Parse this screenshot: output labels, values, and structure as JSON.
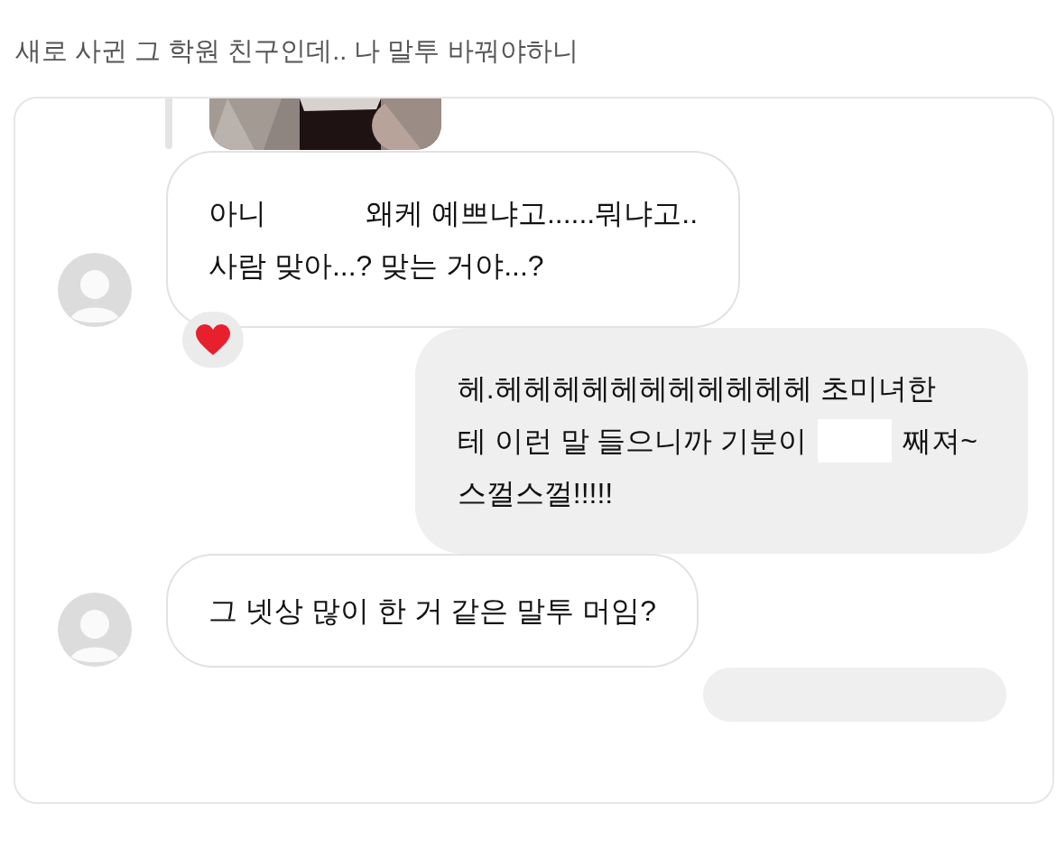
{
  "post_title": "새로 사귄 그 학원 친구인데.. 나 말투 바꿔야하니",
  "chat": {
    "messages": [
      {
        "kind": "incoming",
        "reaction": true,
        "lines": [
          {
            "segments": [
              {
                "kind": "text",
                "text": "아니"
              },
              {
                "kind": "text",
                "text": "왜케 예쁘냐고......뭐냐고.."
              }
            ]
          },
          {
            "segments": [
              {
                "kind": "text",
                "text": "사람 맞아...? 맞는 거야...?"
              }
            ]
          }
        ]
      },
      {
        "kind": "outgoing",
        "lines": [
          {
            "segments": [
              {
                "kind": "text",
                "text": "헤.헤헤헤헤헤헤헤헤헤헤헤 초미녀한"
              }
            ]
          },
          {
            "segments": [
              {
                "kind": "text",
                "text": "테 이런 말 들으니까 기분이"
              },
              {
                "kind": "redaction"
              },
              {
                "kind": "text",
                "text": "째져~"
              }
            ]
          },
          {
            "segments": [
              {
                "kind": "text",
                "text": "스껄스껄!!!!!"
              }
            ]
          }
        ]
      },
      {
        "kind": "incoming",
        "lines": [
          {
            "segments": [
              {
                "kind": "text",
                "text": "그 넷상 많이 한 거 같은 말투 머임?"
              }
            ]
          }
        ]
      },
      {
        "kind": "outgoing"
      }
    ]
  }
}
